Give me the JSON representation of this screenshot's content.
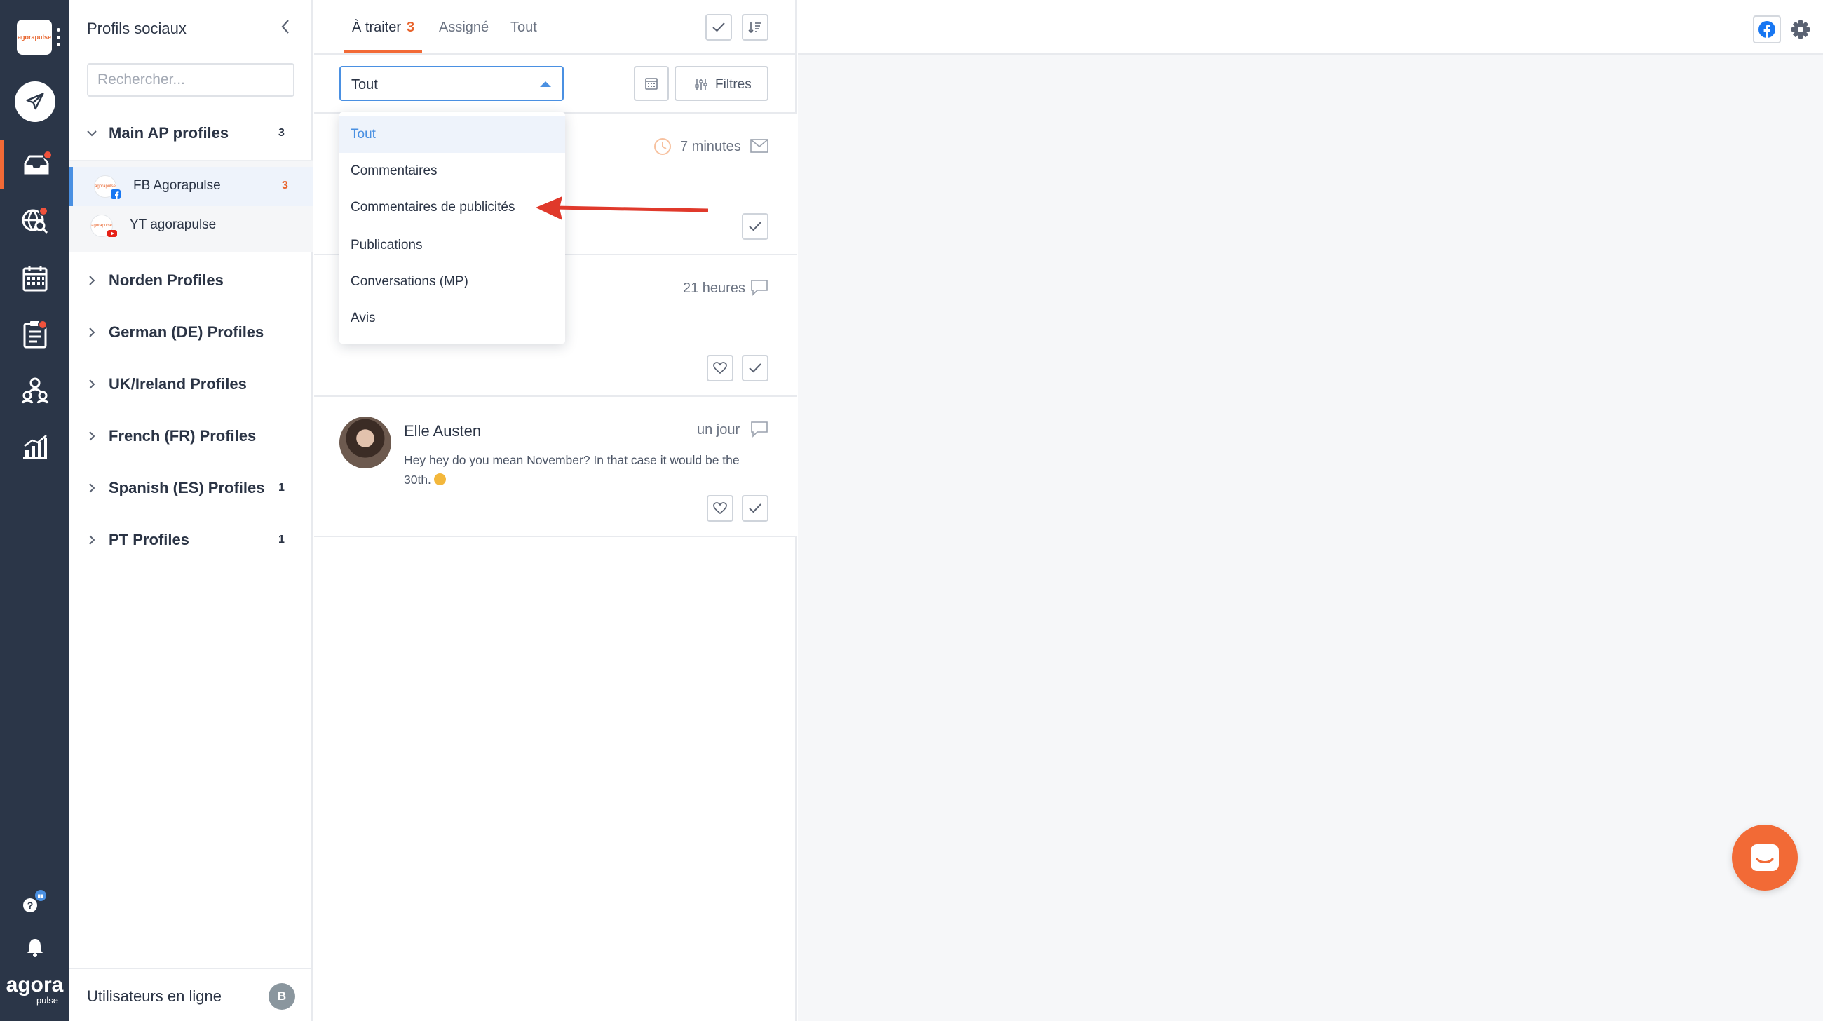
{
  "brand": {
    "logo_text": "agorapulse",
    "wordmark": "agora",
    "wordmark_sub": "pulse",
    "accent": "#f26a36"
  },
  "rail": {
    "items": [
      {
        "icon": "compose-icon"
      },
      {
        "icon": "inbox-icon",
        "active": true,
        "badge": true
      },
      {
        "icon": "listening-icon",
        "badge": true
      },
      {
        "icon": "calendar-icon"
      },
      {
        "icon": "reports-icon",
        "badge": true
      },
      {
        "icon": "team-icon"
      },
      {
        "icon": "analytics-icon"
      }
    ],
    "bottom": [
      {
        "icon": "help-icon"
      },
      {
        "icon": "bell-icon"
      }
    ]
  },
  "sidebar": {
    "title": "Profils sociaux",
    "search_placeholder": "Rechercher...",
    "groups": [
      {
        "name": "Main AP profiles",
        "count": "3",
        "expanded": true
      },
      {
        "name": "Norden Profiles",
        "count": ""
      },
      {
        "name": "German (DE) Profiles",
        "count": ""
      },
      {
        "name": "UK/Ireland Profiles",
        "count": ""
      },
      {
        "name": "French (FR) Profiles",
        "count": ""
      },
      {
        "name": "Spanish (ES) Profiles",
        "count": "1"
      },
      {
        "name": "PT Profiles",
        "count": "1"
      }
    ],
    "profiles": [
      {
        "name": "FB Agorapulse",
        "count": "3",
        "network": "facebook",
        "selected": true
      },
      {
        "name": "YT agorapulse",
        "count": "",
        "network": "youtube"
      }
    ],
    "footer": {
      "label": "Utilisateurs en ligne",
      "avatar_initial": "B"
    }
  },
  "inbox": {
    "tabs": [
      {
        "label": "À traiter",
        "count": "3",
        "active": true
      },
      {
        "label": "Assigné"
      },
      {
        "label": "Tout"
      }
    ],
    "filter": {
      "selected": "Tout",
      "filters_label": "Filtres"
    },
    "dropdown": {
      "options": [
        "Tout",
        "Commentaires",
        "Commentaires de publicités",
        "Publications",
        "Conversations (MP)",
        "Avis"
      ],
      "active_index": 0
    },
    "items": [
      {
        "time": "7 minutes",
        "type": "message"
      },
      {
        "time": "21 heures",
        "type": "comment"
      },
      {
        "author": "Elle Austen",
        "time": "un jour",
        "type": "comment",
        "message": "Hey hey do you mean November? In that case it would be the 30th."
      }
    ]
  },
  "colors": {
    "rail_bg": "#2b3648",
    "link_blue": "#4a90e2",
    "annotation_arrow": "#e0392b"
  }
}
